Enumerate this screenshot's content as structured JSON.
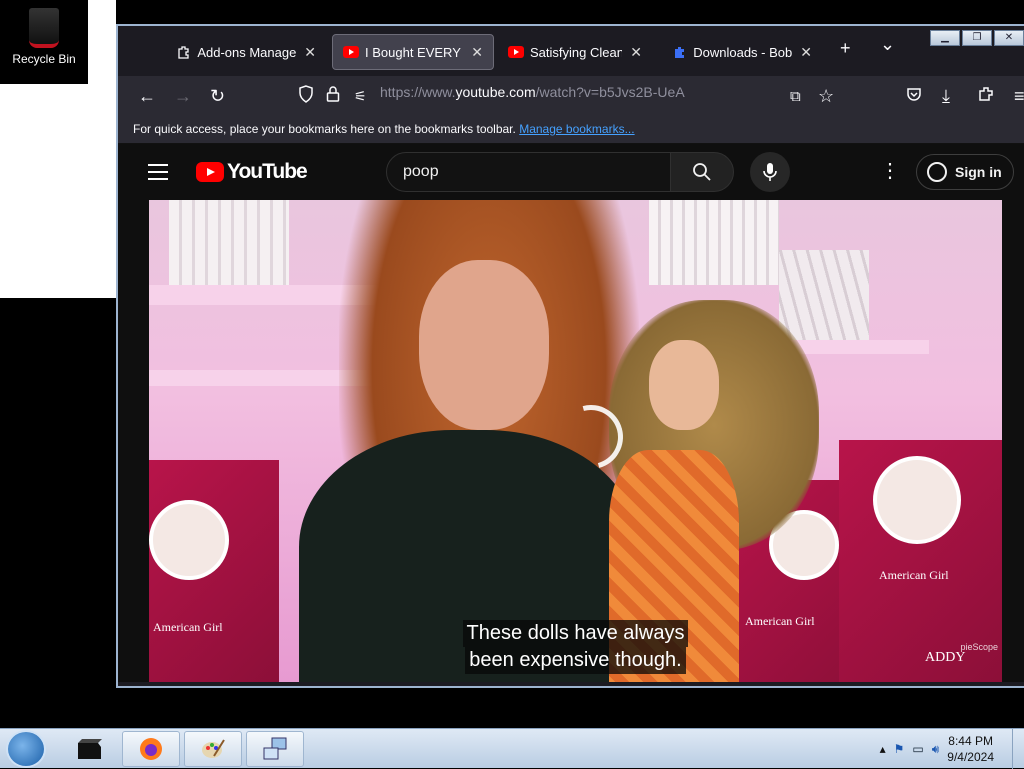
{
  "desktop": {
    "recycle_bin_label": "Recycle Bin"
  },
  "window": {
    "caption_buttons": [
      "minimize",
      "restore",
      "close"
    ]
  },
  "tabs": [
    {
      "label": "Add-ons Manager",
      "icon": "puzzle-icon",
      "active": false
    },
    {
      "label": "I Bought EVERY Am",
      "icon": "youtube-icon",
      "active": true
    },
    {
      "label": "Satisfying Cleaning/",
      "icon": "youtube-icon",
      "active": false
    },
    {
      "label": "Downloads - Bob Pe",
      "icon": "puzzle-blue-icon",
      "active": false
    }
  ],
  "tab_controls": {
    "new_tab": "+",
    "list_all": "⌄"
  },
  "navbar": {
    "url_prefix": "https://www.",
    "url_host": "youtube.com",
    "url_path": "/watch?v=b5Jvs2B-UeA"
  },
  "bookmarks_bar": {
    "message": "For quick access, place your bookmarks here on the bookmarks toolbar.",
    "link": "Manage bookmarks..."
  },
  "youtube": {
    "logo_text": "YouTube",
    "search_value": "poop",
    "sign_in_label": "Sign in"
  },
  "video": {
    "caption_line1": "These dolls have always",
    "caption_line2": "been expensive though.",
    "brand_text": "American Girl",
    "brand_text_2": "ADDY",
    "watermark": "pieScope"
  },
  "taskbar": {
    "time": "8:44 PM",
    "date": "9/4/2024",
    "items": [
      "black-box-icon",
      "firefox-icon",
      "paint-icon",
      "network-icon"
    ]
  },
  "colors": {
    "youtube_red": "#ff0000",
    "firefox_dark": "#1c1b22",
    "link_blue": "#45a1ff"
  }
}
